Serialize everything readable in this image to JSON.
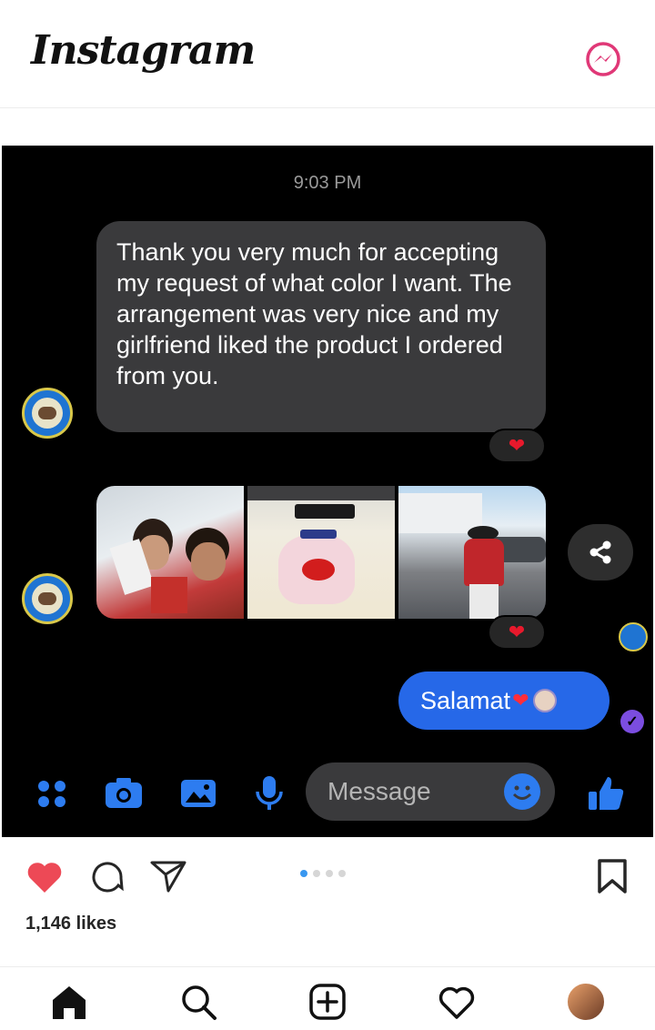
{
  "instagram": {
    "logo_text": "Instagram",
    "likes_text": "1,146 likes",
    "carousel": {
      "total": 4,
      "active_index": 0
    },
    "accent_color": "#e03877"
  },
  "chat": {
    "timestamp": "9:03 PM",
    "incoming_message": "Thank you very much for accepting my request of what color I want. The arrangement was very nice and my girlfriend liked the product I ordered from you.",
    "message_reaction": "❤",
    "photos_reaction": "❤",
    "outgoing_message": "Salamat",
    "outgoing_emoji": "❤",
    "composer_placeholder": "Message",
    "delivered_mark": "✓"
  },
  "icons": {
    "header": [
      "messenger-icon"
    ],
    "composer": [
      "apps-icon",
      "camera-icon",
      "gallery-icon",
      "microphone-icon",
      "emoji-icon",
      "thumbs-up-icon"
    ],
    "post_actions": [
      "heart-icon",
      "comment-icon",
      "send-icon",
      "bookmark-icon"
    ],
    "tabbar": [
      "home-icon",
      "search-icon",
      "new-post-icon",
      "activity-icon",
      "profile-avatar"
    ]
  },
  "colors": {
    "chat_background": "#000000",
    "incoming_bubble": "#3a3a3c",
    "outgoing_bubble": "#2668e8",
    "messenger_blue": "#2d7cf0",
    "like_red": "#ed4956"
  }
}
